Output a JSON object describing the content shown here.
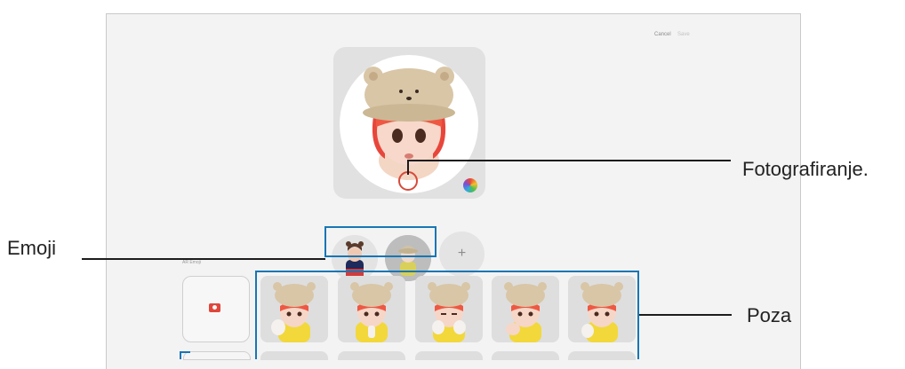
{
  "topbar": {
    "cancel_label": "Cancel",
    "save_label": "Save"
  },
  "section": {
    "label": "AR Emoji"
  },
  "emojis": [
    {
      "name": "emoji-1"
    },
    {
      "name": "emoji-2"
    }
  ],
  "add_button": {
    "symbol": "+"
  },
  "poses": [
    "pose-1",
    "pose-2",
    "pose-3",
    "pose-4",
    "pose-5"
  ],
  "callouts": {
    "capture": "Fotografiranje.",
    "emoji": "Emoji",
    "pose": "Poza"
  },
  "colors": {
    "accent": "#1776b5",
    "capture": "#d64a3b",
    "camera": "#e0463a"
  }
}
